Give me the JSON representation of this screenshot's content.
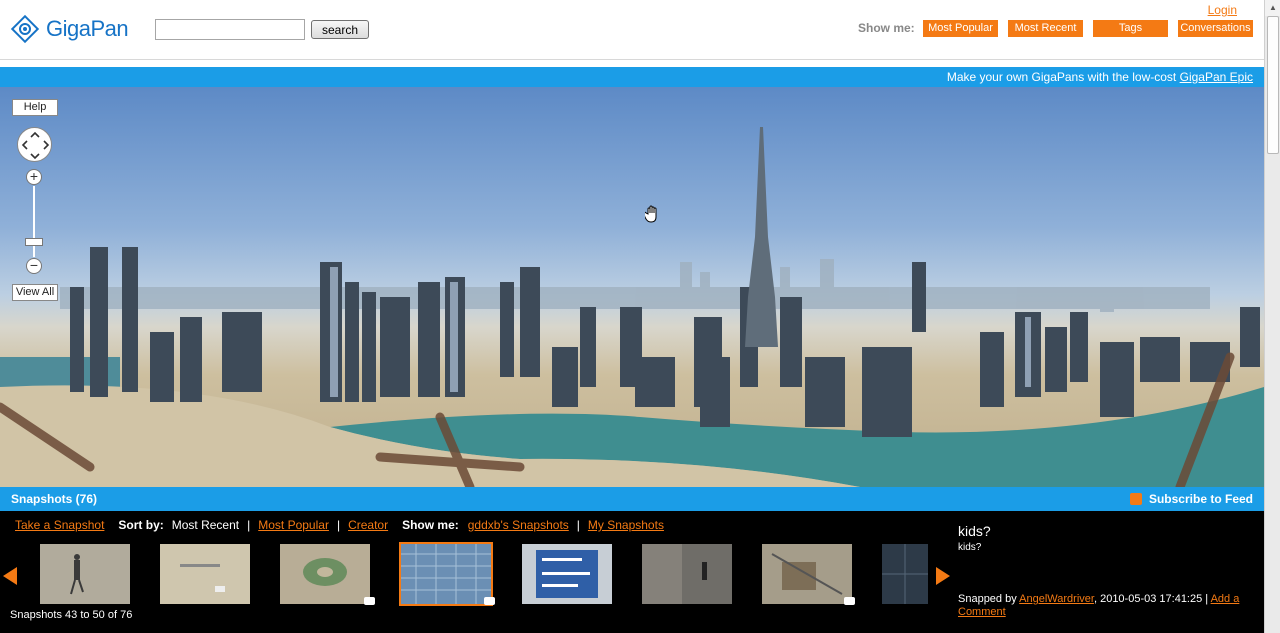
{
  "header": {
    "logo_text": "GigaPan",
    "search_placeholder": "",
    "search_button": "search",
    "login": "Login",
    "show_me_label": "Show me:",
    "nav": [
      "Most Popular",
      "Most Recent",
      "Tags",
      "Conversations"
    ]
  },
  "promo": {
    "text": "Make your own GigaPans with the low-cost ",
    "link": "GigaPan Epic"
  },
  "viewer": {
    "help": "Help",
    "view_all": "View All",
    "zoom_in": "+",
    "zoom_out": "−"
  },
  "snapshots_bar": {
    "title": "Snapshots (76)",
    "subscribe": "Subscribe to Feed"
  },
  "strip": {
    "take_snapshot": "Take a Snapshot",
    "sort_by_label": "Sort by:",
    "sort_current": "Most Recent",
    "sort_popular": "Most Popular",
    "sort_creator": "Creator",
    "show_me_label": "Show me:",
    "user_snapshots": "gddxb's Snapshots",
    "my_snapshots": "My Snapshots",
    "count": "Snapshots 43 to 50 of 76"
  },
  "detail": {
    "title": "kids?",
    "subtitle": "kids?",
    "snapped_by": "Snapped by ",
    "author": "AngelWardriver",
    "date": ", 2010-05-03 17:41:25 | ",
    "add_comment": "Add a Comment"
  },
  "colors": {
    "accent": "#f47a14",
    "bar_blue": "#1b9de7",
    "logo_blue": "#1673c6"
  }
}
